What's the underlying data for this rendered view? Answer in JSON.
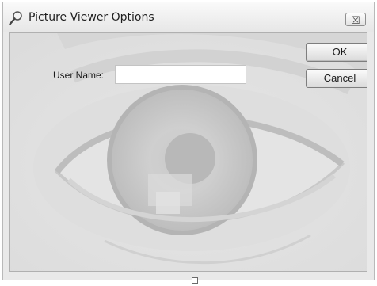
{
  "window": {
    "title": "Picture Viewer Options",
    "close_label": "☒"
  },
  "form": {
    "username_label": "User Name:",
    "username_value": "",
    "ok_label": "OK",
    "cancel_label": "Cancel"
  },
  "icons": {
    "app": "magnifier-icon",
    "close": "close-icon",
    "background": "eye-photo"
  },
  "colors": {
    "window_bg": "#e9e9e9",
    "field_bg": "#ffffff",
    "border": "#b9b9b9"
  }
}
